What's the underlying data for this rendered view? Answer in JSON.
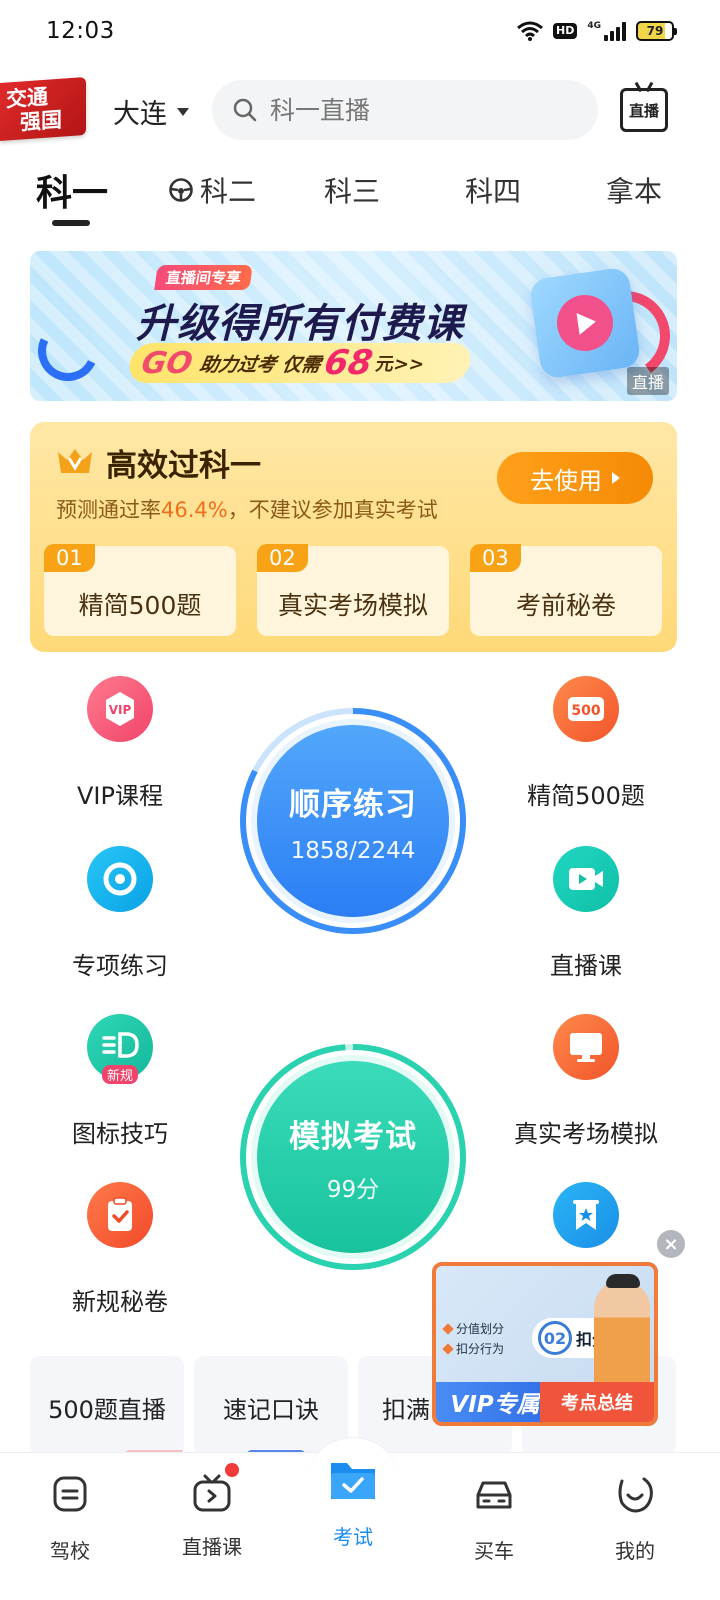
{
  "status_bar": {
    "time": "12:03",
    "hd": "HD",
    "network": "4G",
    "battery": "79"
  },
  "header": {
    "logo_line1": "交通",
    "logo_line2": "强国",
    "city": "大连",
    "search_placeholder": "科一直播",
    "live_icon_label": "直播"
  },
  "tabs": [
    {
      "label": "科一",
      "active": true
    },
    {
      "label": "科二"
    },
    {
      "label": "科三"
    },
    {
      "label": "科四"
    },
    {
      "label": "拿本"
    }
  ],
  "banner": {
    "tag": "直播间专享",
    "title": "升级得所有付费课",
    "go": "GO",
    "sub_text": "助力过考 仅需",
    "price": "68",
    "unit": "元>>",
    "corner_label": "直播"
  },
  "efficient_card": {
    "title": "高效过科一",
    "desc_prefix": "预测通过率",
    "pass_rate": "46.4%",
    "desc_suffix": "，不建议参加真实考试",
    "button_label": "去使用",
    "items": [
      {
        "num": "01",
        "label": "精简500题"
      },
      {
        "num": "02",
        "label": "真实考场模拟"
      },
      {
        "num": "03",
        "label": "考前秘卷"
      }
    ]
  },
  "features": {
    "vip_course": "VIP课程",
    "vip_icon_text": "VIP",
    "simplified_500": "精简500题",
    "icon_500_text": "500",
    "special_practice": "专项练习",
    "live_course": "直播课",
    "sign_tips": "图标技巧",
    "new_badge": "新规",
    "real_exam": "真实考场模拟",
    "new_secret": "新规秘卷"
  },
  "order_practice": {
    "title": "顺序练习",
    "progress": "1858/2244",
    "done": 1858,
    "total": 2244
  },
  "mock_exam": {
    "title": "模拟考试",
    "score": "99分",
    "score_value": 99
  },
  "quick_cards": [
    "500题直播",
    "速记口诀",
    "扣满"
  ],
  "floating_video": {
    "line1": "分值划分",
    "line2": "扣分行为",
    "pill_num": "02",
    "pill_text": "扣分分值",
    "vip": "VIP专属",
    "summary": "考点总结"
  },
  "bottom_nav": [
    {
      "label": "驾校"
    },
    {
      "label": "直播课"
    },
    {
      "label": "考试",
      "active": true
    },
    {
      "label": "买车"
    },
    {
      "label": "我的"
    }
  ],
  "colors": {
    "accent_blue": "#1b8cf0",
    "order_blue": "#2b7ef4",
    "mock_green": "#18c39c",
    "gold": "#ffd978",
    "orange": "#f58a05"
  }
}
